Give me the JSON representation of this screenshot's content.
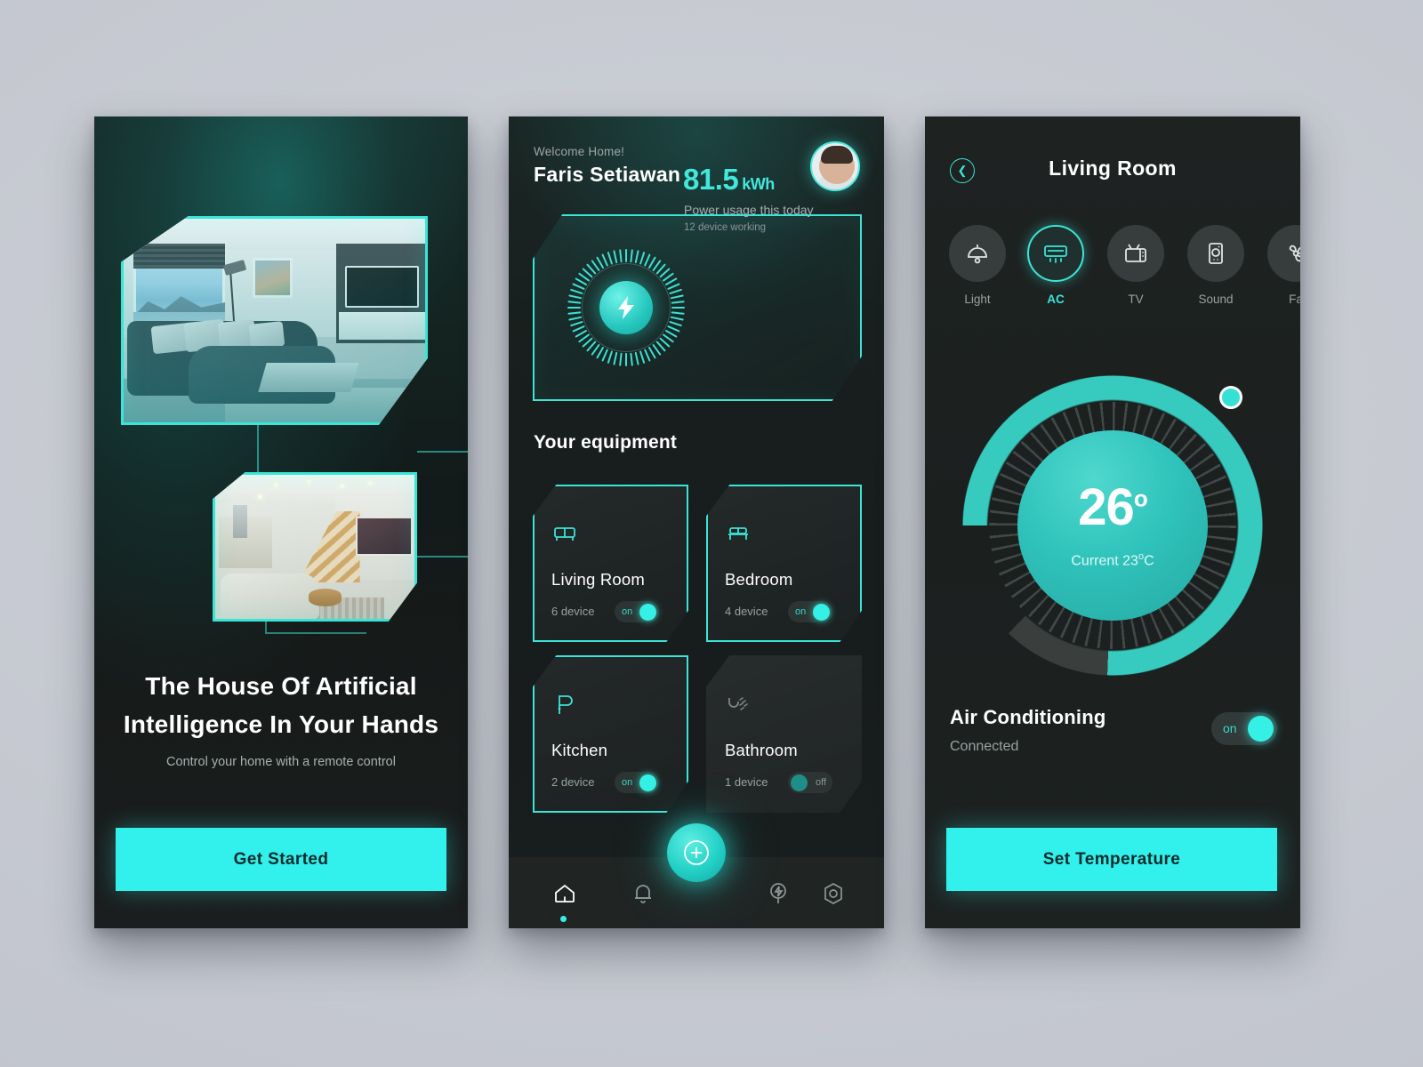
{
  "theme": {
    "accent": "#32f0eb",
    "accent_dim": "#3be4d7",
    "bg": "#c7cad2",
    "panel": "#1b201f",
    "text": "#ffffff",
    "muted": "#9aa1a2"
  },
  "screen1": {
    "name": "onboarding",
    "photos": [
      {
        "name": "living-room-sea-view"
      },
      {
        "name": "kitchen-staircase-lounge"
      }
    ],
    "title_line1": "The House Of Artificial",
    "title_line2": "Intelligence In Your Hands",
    "subtitle": "Control your home with a remote control",
    "cta_label": "Get Started"
  },
  "screen2": {
    "name": "home-dashboard",
    "welcome": "Welcome Home!",
    "username": "Faris Setiawan",
    "avatar_icon": "user-avatar",
    "power": {
      "value": "81.5",
      "unit": "kWh",
      "caption": "Power usage this today",
      "subcaption": "12 device working",
      "gauge_icon": "bolt-icon"
    },
    "section_title": "Your equipment",
    "equipment": [
      {
        "name": "Living Room",
        "devices": "6 device",
        "state": "on",
        "state_label": "on",
        "icon": "sofa-icon"
      },
      {
        "name": "Bedroom",
        "devices": "4 device",
        "state": "on",
        "state_label": "on",
        "icon": "bed-icon"
      },
      {
        "name": "Kitchen",
        "devices": "2 device",
        "state": "on",
        "state_label": "on",
        "icon": "knife-icon"
      },
      {
        "name": "Bathroom",
        "devices": "1 device",
        "state": "off",
        "state_label": "off",
        "icon": "shower-icon"
      }
    ],
    "nav": [
      {
        "icon": "home-icon",
        "active": true
      },
      {
        "icon": "bell-icon",
        "active": false
      },
      {
        "icon": "plus-icon",
        "active": false
      },
      {
        "icon": "bolt-pin-icon",
        "active": false
      },
      {
        "icon": "settings-icon",
        "active": false
      }
    ]
  },
  "screen3": {
    "name": "room-detail",
    "back_icon": "chevron-left-icon",
    "room_title": "Living Room",
    "tabs": [
      {
        "label": "Light",
        "icon": "lamp-icon",
        "active": false
      },
      {
        "label": "AC",
        "icon": "ac-unit-icon",
        "active": true
      },
      {
        "label": "TV",
        "icon": "tv-icon",
        "active": false
      },
      {
        "label": "Sound",
        "icon": "speaker-icon",
        "active": false
      },
      {
        "label": "Fa",
        "icon": "fan-icon",
        "active": false
      }
    ],
    "dial": {
      "target_temp": "26",
      "degree_symbol": "o",
      "current_label": "Current 23",
      "current_unit": "C",
      "progress_percent": 88
    },
    "device_name": "Air Conditioning",
    "device_status": "Connected",
    "device_toggle_label": "on",
    "device_toggle_state": "on",
    "cta_label": "Set Temperature"
  }
}
